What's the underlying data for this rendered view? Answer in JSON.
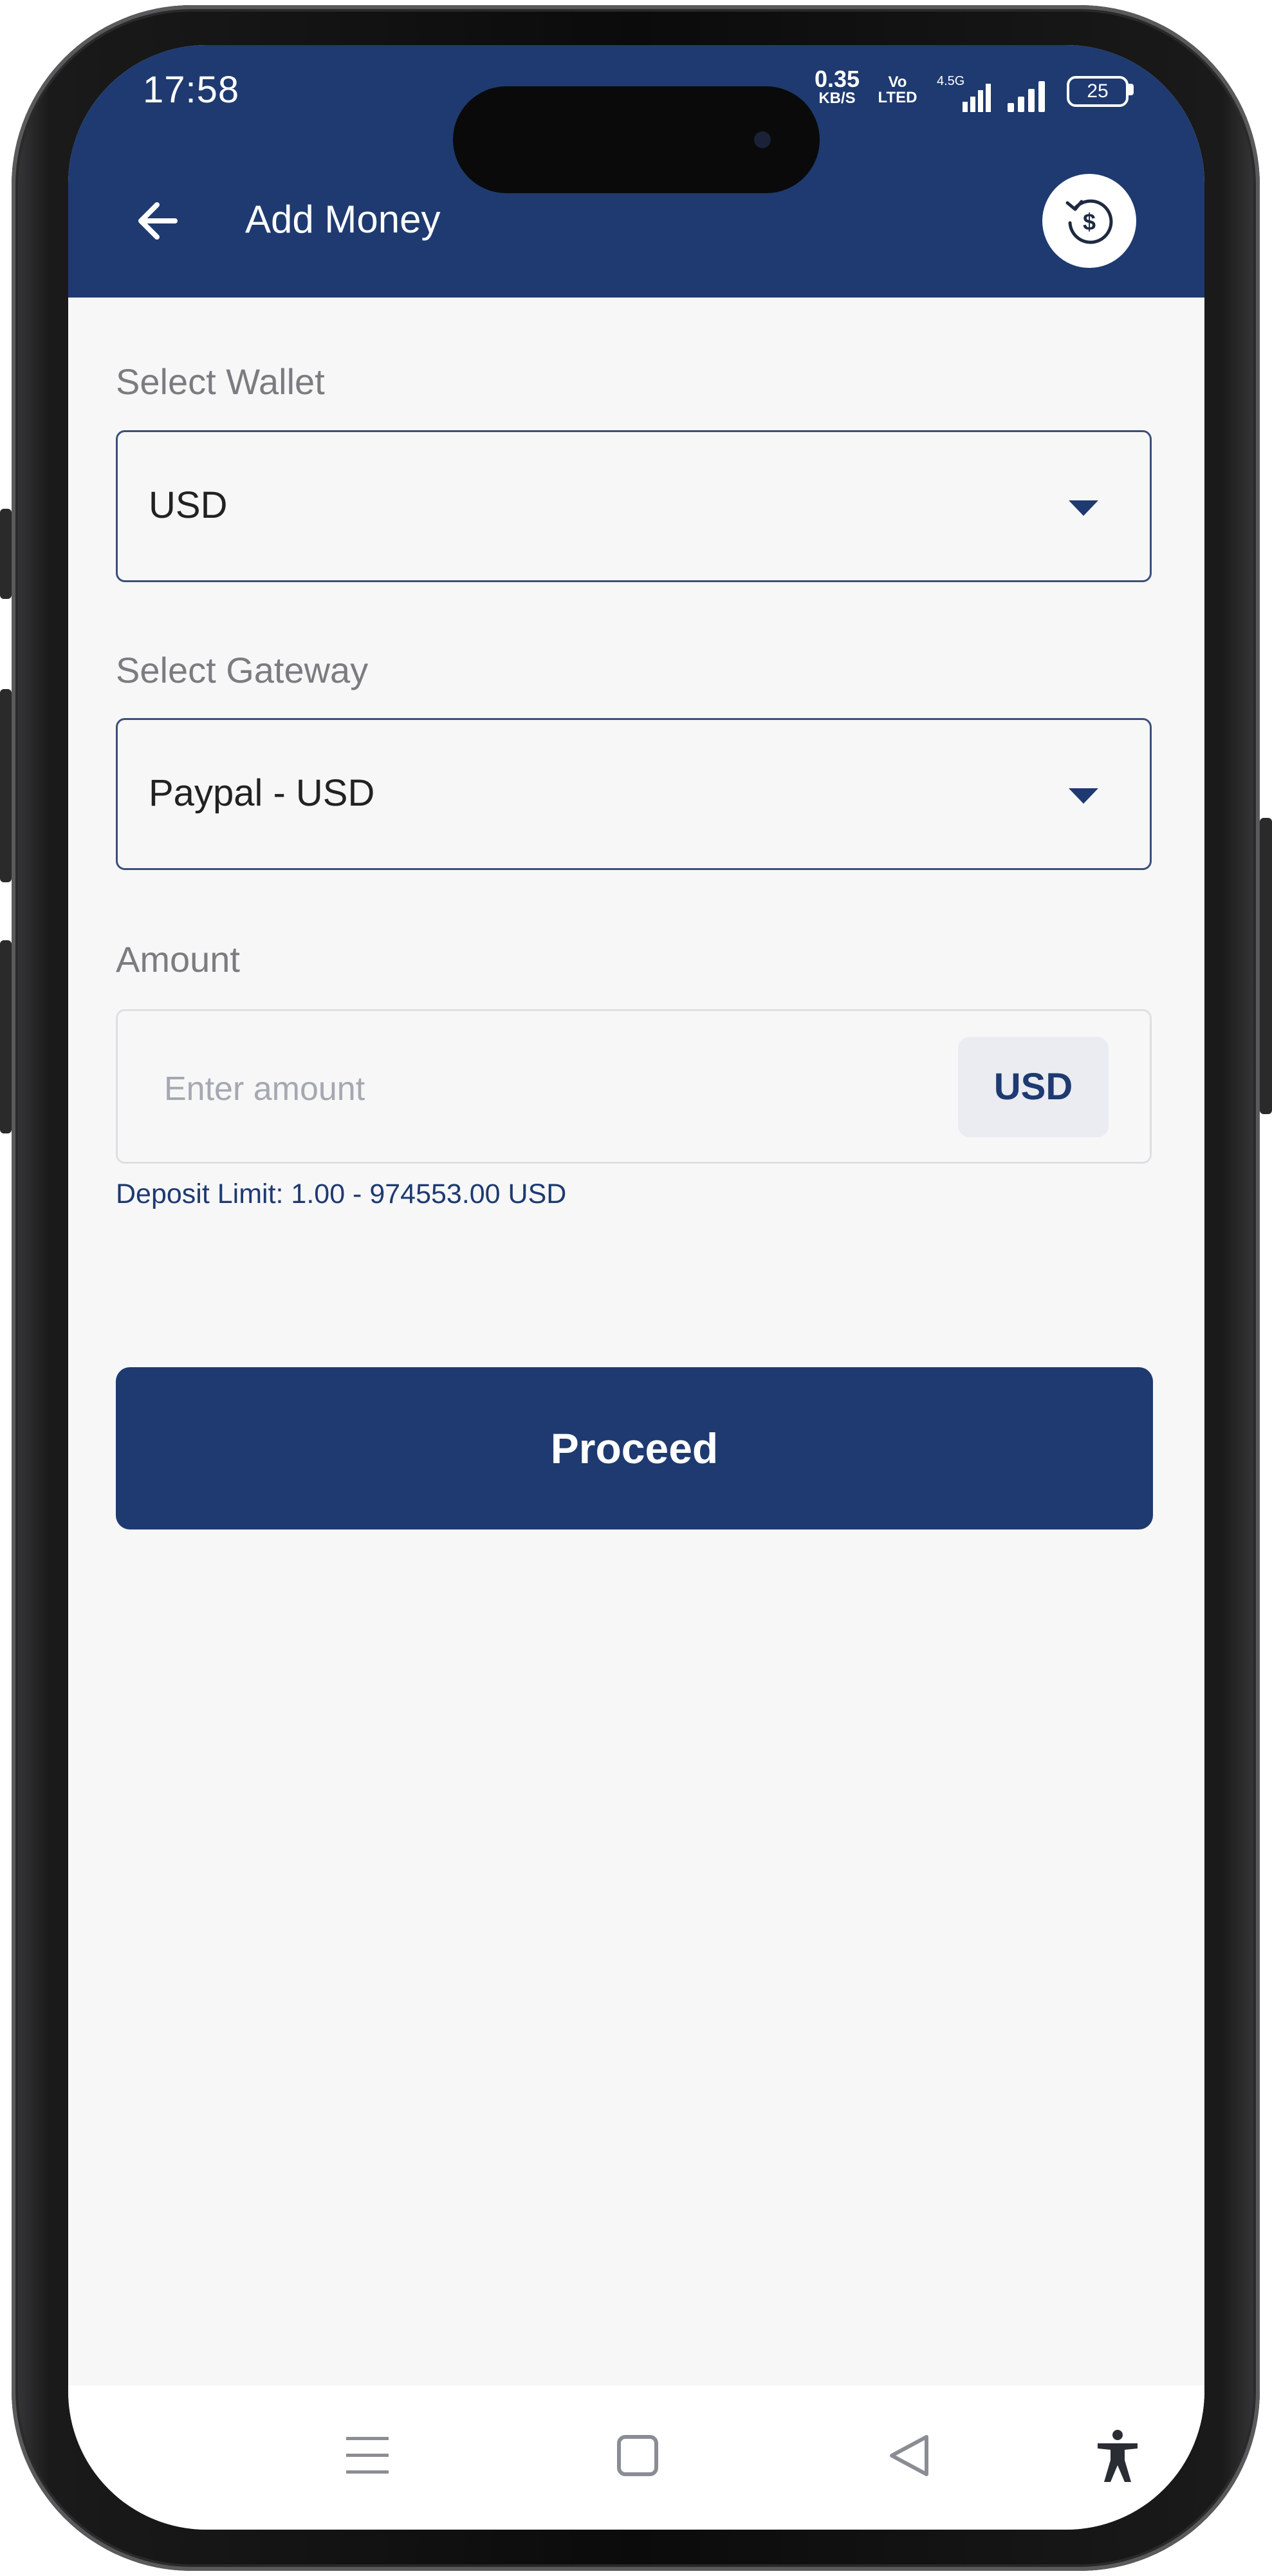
{
  "status_bar": {
    "time": "17:58",
    "net_speed_value": "0.35",
    "net_speed_unit": "KB/S",
    "volte_top": "Vo",
    "volte_bottom": "LTED",
    "network_type": "4.5G",
    "battery": "25"
  },
  "header": {
    "title": "Add Money",
    "back_icon": "arrow-left-icon",
    "history_icon": "currency-history-icon"
  },
  "form": {
    "wallet_label": "Select Wallet",
    "wallet_value": "USD",
    "gateway_label": "Select Gateway",
    "gateway_value": "Paypal - USD",
    "amount_label": "Amount",
    "amount_placeholder": "Enter amount",
    "amount_currency": "USD",
    "deposit_limit": "Deposit Limit: 1.00 - 974553.00 USD"
  },
  "actions": {
    "proceed_label": "Proceed"
  },
  "nav_bar": {
    "icons": [
      "menu-icon",
      "home-square-icon",
      "back-triangle-icon",
      "accessibility-icon"
    ]
  },
  "colors": {
    "primary": "#1e3a70",
    "background": "#f7f7f8",
    "label": "#7c7c80",
    "placeholder": "#a5a8b0"
  }
}
